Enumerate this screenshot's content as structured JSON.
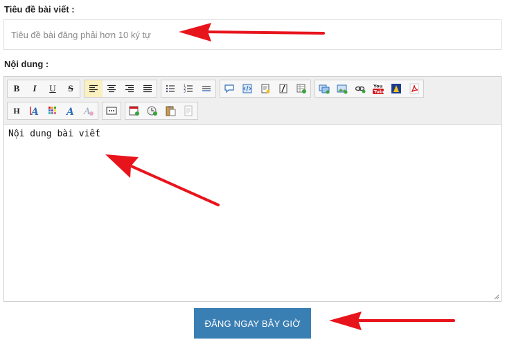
{
  "form": {
    "title_label": "Tiêu đề bài viết :",
    "title_placeholder": "Tiêu đề bài đăng phải hơn 10 ký tự",
    "content_label": "Nội dung :",
    "content_text": "Nội dung bài viết",
    "submit_label": "ĐĂNG NGAY BÂY GIỜ"
  },
  "toolbar": {
    "bold": "B",
    "italic": "I",
    "underline": "U",
    "strikethrough": "S",
    "heading": "H",
    "active_button": "align-left"
  },
  "colors": {
    "submit_bg": "#3a7fb4",
    "arrow": "#e8141c",
    "toolbar_bg": "#efefef",
    "active_bg": "#fbf0c0"
  }
}
